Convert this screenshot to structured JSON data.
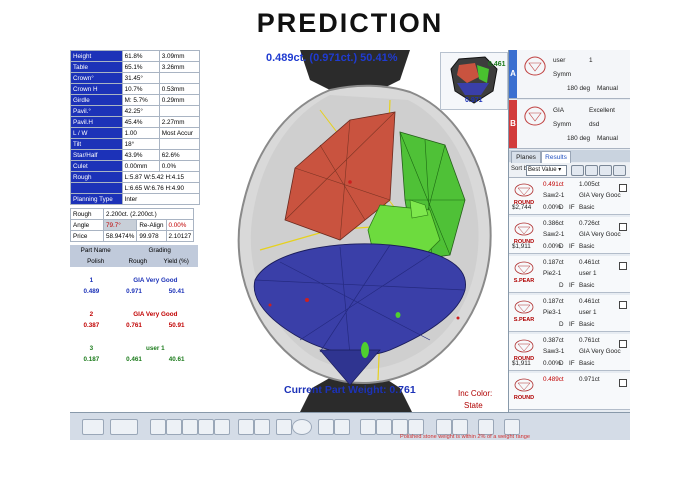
{
  "heading": "PREDICTION",
  "measurements": [
    {
      "label": "Height",
      "v1": "61.8%",
      "v2": "3.09mm"
    },
    {
      "label": "Table",
      "v1": "65.1%",
      "v2": "3.26mm"
    },
    {
      "label": "Crown°",
      "v1": "31.45°",
      "v2": ""
    },
    {
      "label": "Crown H",
      "v1": "10.7%",
      "v2": "0.53mm"
    },
    {
      "label": "Girdle",
      "v1": "M: 5.7%",
      "v2": "0.29mm"
    },
    {
      "label": "Pavil.°",
      "v1": "42.25°",
      "v2": ""
    },
    {
      "label": "Pavil.H",
      "v1": "45.4%",
      "v2": "2.27mm"
    },
    {
      "label": "L / W",
      "v1": "1.00",
      "v2": "Most Accur"
    },
    {
      "label": "Tilt",
      "v1": "18°",
      "v2": ""
    },
    {
      "label": "Star/Half",
      "v1": "43.9%",
      "v2": "62.6%"
    },
    {
      "label": "Culet",
      "v1": "0.00mm",
      "v2": "0.0%"
    },
    {
      "label": "Rough",
      "span": "L:5.87 W:5.42 H:4.15"
    },
    {
      "label": "",
      "span": "L:6.65 W:6.76 H:4.90"
    },
    {
      "label": "Planning Type",
      "span": "Inter"
    }
  ],
  "rough": {
    "rough_label": "Rough",
    "rough_value": "2.200ct. (2.200ct.)",
    "angle_label": "Angle",
    "angle_value": "79.7°",
    "realign_label": "Re-Align",
    "angle_pct": "0.00%",
    "price_label": "Price",
    "price_pct": "58.9474%",
    "price_v2": "99.978",
    "price_v3": "2.10127"
  },
  "parts_header": {
    "part_name": "Part Name",
    "grading": "Grading",
    "polish": "Polish",
    "rough": "Rough",
    "yield": "Yield (%)"
  },
  "parts": [
    {
      "num": "1",
      "grade": "GIA Very Good",
      "a": "0.489",
      "b": "0.971",
      "c": "50.41",
      "color": "#1c32b8",
      "grade_color": "#1c32b8"
    },
    {
      "num": "2",
      "grade": "GIA Very Good",
      "a": "0.387",
      "b": "0.761",
      "c": "50.91",
      "color": "#c00000",
      "grade_color": "#c00000"
    },
    {
      "num": "3",
      "grade": "user 1",
      "a": "0.187",
      "b": "0.461",
      "c": "40.61",
      "color": "#1a7a1a",
      "grade_color": "#1a7a1a"
    }
  ],
  "viewport": {
    "weight_top": "0.489ct. (0.971ct.) 50.41%",
    "weight_bottom": "Current Part Weight: 0.761",
    "inc_label": "Inc Color:",
    "inc_value": "State",
    "thumb_val1": "0.461",
    "thumb_val2": "0.971"
  },
  "cards": [
    {
      "tag": "A",
      "tag_color": "#3a6fd0",
      "line1": "user",
      "line1b": "1",
      "line2": "Symm",
      "line3": "180 deg",
      "line3b": "Manual"
    },
    {
      "tag": "B",
      "tag_color": "#d23b3b",
      "line1": "GIA",
      "line1b": "Excellent",
      "line2": "Symm",
      "line2b": "dsd",
      "line3": "180 deg",
      "line3b": "Manual"
    }
  ],
  "tabs": {
    "planes": "Planes",
    "results": "Results"
  },
  "sort": {
    "label": "Sort by:",
    "value": "Best Value"
  },
  "results": [
    {
      "badge": "ROUND",
      "w1": "0.491ct",
      "w2": "1.005ct",
      "name": "Saw2-1",
      "grade": "GIA Very Gooc",
      "price": "$2,744",
      "c": "0.00%",
      "cl": "D",
      "q": "IF",
      "cut": "Basic",
      "red": true
    },
    {
      "badge": "ROUND",
      "w1": "0.386ct",
      "w2": "0.726ct",
      "name": "Saw2-1",
      "grade": "GIA Very Gooc",
      "price": "$1,911",
      "c": "0.00%",
      "cl": "D",
      "q": "IF",
      "cut": "Basic",
      "red": false
    },
    {
      "badge": "S.PEAR",
      "w1": "0.187ct",
      "w2": "0.461ct",
      "name": "Pie2-1",
      "grade": "user 1",
      "price": "",
      "c": "",
      "cl": "D",
      "q": "IF",
      "cut": "Basic",
      "red": false
    },
    {
      "badge": "S.PEAR",
      "w1": "0.187ct",
      "w2": "0.461ct",
      "name": "Pie3-1",
      "grade": "user 1",
      "price": "",
      "c": "",
      "cl": "D",
      "q": "IF",
      "cut": "Basic",
      "red": false
    },
    {
      "badge": "ROUND",
      "w1": "0.387ct",
      "w2": "0.761ct",
      "name": "Saw3-1",
      "grade": "GIA Very Gooc",
      "price": "$1,911",
      "c": "0.00%",
      "cl": "D",
      "q": "IF",
      "cut": "Basic",
      "red": false
    },
    {
      "badge": "ROUND",
      "w1": "0.489ct",
      "w2": "0.971ct",
      "name": "",
      "grade": "",
      "price": "",
      "c": "",
      "cl": "",
      "q": "",
      "cut": "",
      "red": true
    }
  ],
  "status": "Polished stone weight is within 2% of a weight range",
  "colors": {
    "red_part": "#c9533f",
    "green_part": "#3fbf2f",
    "blue_part": "#3a3fa8",
    "accent": "#1c32b8"
  }
}
